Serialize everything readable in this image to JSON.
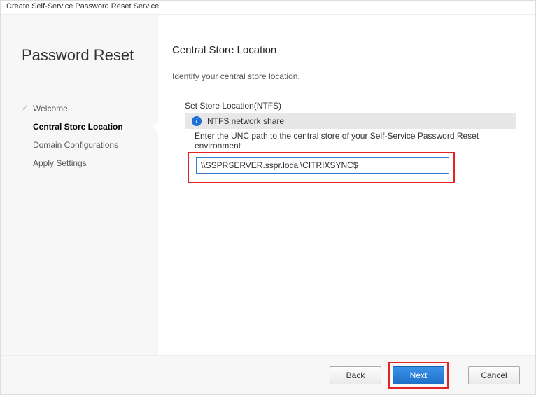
{
  "window": {
    "title": "Create Self-Service Password Reset Service"
  },
  "sidebar": {
    "heading": "Password Reset",
    "steps": [
      {
        "label": "Welcome",
        "completed": true
      },
      {
        "label": "Central Store Location",
        "active": true
      },
      {
        "label": "Domain Configurations"
      },
      {
        "label": "Apply Settings"
      }
    ]
  },
  "main": {
    "heading": "Central Store Location",
    "instruction": "Identify your central store location.",
    "subheading": "Set Store Location(NTFS)",
    "share_label": "NTFS network share",
    "hint": "Enter the UNC path to the central store of your Self-Service Password Reset environment",
    "unc_value": "\\\\SSPRSERVER.sspr.local\\CITRIXSYNC$"
  },
  "footer": {
    "back": "Back",
    "next": "Next",
    "cancel": "Cancel"
  }
}
